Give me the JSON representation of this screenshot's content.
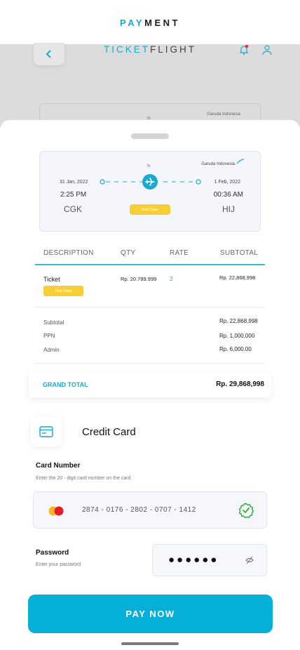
{
  "topbar": {
    "title_part1": "PAY",
    "title_part2": "MENT"
  },
  "background": {
    "brand_part1": "TICKET",
    "brand_part2": "FLIGHT",
    "airline": "Garuda Indonesia",
    "duration": "7h"
  },
  "flight": {
    "airline": "Garuda Indonesia",
    "duration": "7h",
    "departure": {
      "date": "31 Jan, 2022",
      "time": "2:25 PM",
      "code": "CGK"
    },
    "arrival": {
      "date": "1 Feb, 2022",
      "time": "00:36 AM",
      "code": "HIJ"
    },
    "class": "First Class"
  },
  "table": {
    "headers": {
      "description": "DESCRIPTION",
      "qty": "QTY",
      "rate": "RATE",
      "subtotal": "SUBTOTAL"
    },
    "item": {
      "name": "Ticket",
      "class": "First Class",
      "qty": "Rp. 20.789.999",
      "rate": "2",
      "subtotal": "Rp. 22,868,998"
    }
  },
  "summary": [
    {
      "label": "Subtotal",
      "value": "Rp. 22,868,998"
    },
    {
      "label": "PPN",
      "value": "Rp. 1,000,000"
    },
    {
      "label": "Admin",
      "value": "Rp. 6,000.00"
    }
  ],
  "grand_total": {
    "label": "GRAND TOTAL",
    "value": "Rp. 29,868,998"
  },
  "payment_method": {
    "title": "Credit Card",
    "icon": "credit-card-icon"
  },
  "card_number": {
    "label": "Card Number",
    "help": "Enter the 20 - digit card number on the card",
    "value": "2874  -  0176  -  2802  -  0707  -  1412"
  },
  "password": {
    "label": "Password",
    "help": "Enter your password",
    "value": "●●●●●●"
  },
  "pay_button": {
    "label": "PAY NOW"
  },
  "colors": {
    "accent": "#04b0d8",
    "badge": "#f6cf36",
    "success": "#2fae3a"
  }
}
